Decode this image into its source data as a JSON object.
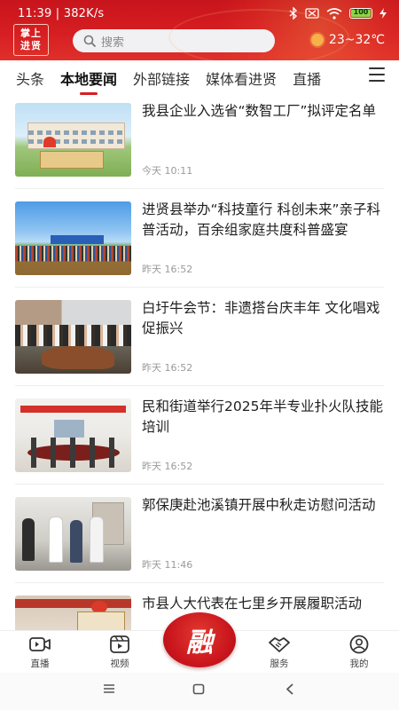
{
  "status_bar": {
    "time": "11:39",
    "network_speed": "382K/s",
    "battery": "100"
  },
  "header": {
    "logo_line1": "掌上",
    "logo_line2": "进贤",
    "search_placeholder": "搜索",
    "weather": "23~32℃",
    "accent_color": "#d61e22"
  },
  "tabs": [
    {
      "label": "头条",
      "active": false
    },
    {
      "label": "本地要闻",
      "active": true
    },
    {
      "label": "外部链接",
      "active": false
    },
    {
      "label": "媒体看进贤",
      "active": false
    },
    {
      "label": "直播",
      "active": false
    }
  ],
  "news": [
    {
      "title": "我县企业入选省“数智工厂”拟评定名单",
      "time": "今天 10:11"
    },
    {
      "title": "进贤县举办“科技童行 科创未来”亲子科普活动，百余组家庭共度科普盛宴",
      "time": "昨天 16:52"
    },
    {
      "title": "白圩牛会节：非遗搭台庆丰年 文化唱戏促振兴",
      "time": "昨天 16:52"
    },
    {
      "title": "民和街道举行2025年半专业扑火队技能培训",
      "time": "昨天 16:52"
    },
    {
      "title": "郭保庚赴池溪镇开展中秋走访慰问活动",
      "time": "昨天 11:46"
    },
    {
      "title": "市县人大代表在七里乡开展履职活动",
      "time": ""
    }
  ],
  "bottom_nav": {
    "live": "直播",
    "video": "视频",
    "center_icon": "融",
    "service": "服务",
    "mine": "我的"
  }
}
